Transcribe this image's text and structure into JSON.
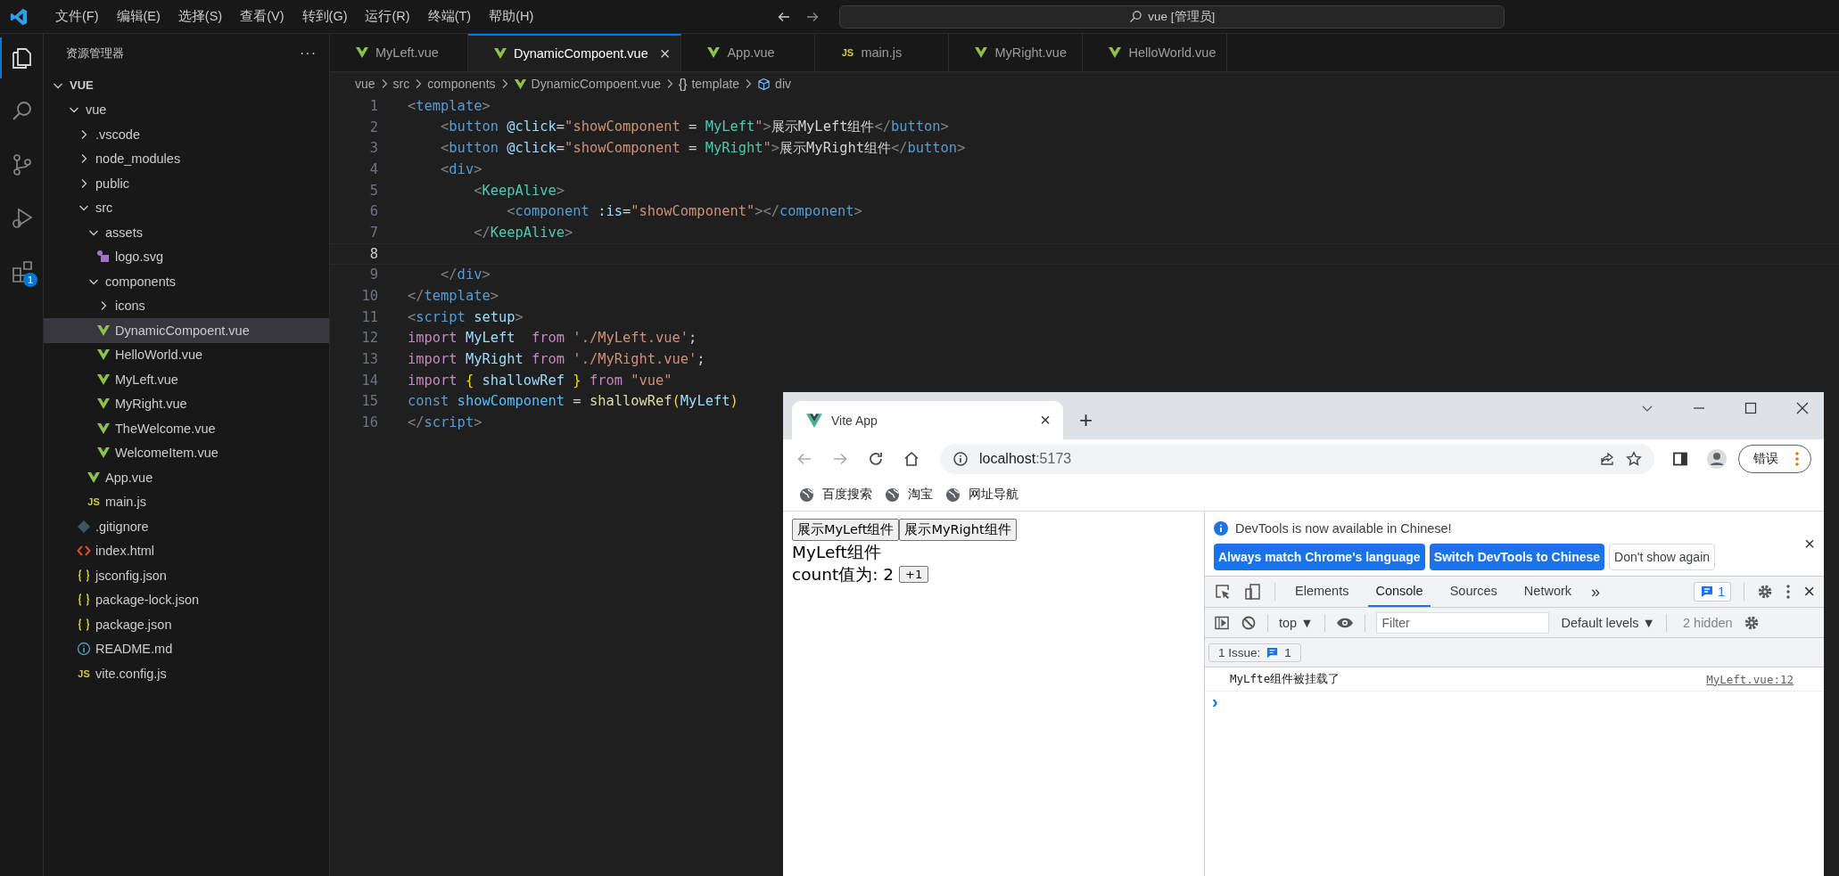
{
  "menu": [
    "文件(F)",
    "编辑(E)",
    "选择(S)",
    "查看(V)",
    "转到(G)",
    "运行(R)",
    "终端(T)",
    "帮助(H)"
  ],
  "command_center": {
    "text": "vue [管理员]"
  },
  "activity_bar": [
    {
      "kind": "files",
      "selected": true
    },
    {
      "kind": "search",
      "selected": false
    },
    {
      "kind": "source-control",
      "selected": false
    },
    {
      "kind": "run-debug",
      "selected": false
    },
    {
      "kind": "extensions",
      "selected": false,
      "badge": "1"
    }
  ],
  "explorer": {
    "title": "资源管理器",
    "more": "···",
    "root": {
      "label": "VUE",
      "expanded": true
    },
    "items": [
      {
        "label": "vue",
        "kind": "folder",
        "expanded": true,
        "selected": false,
        "children": [
          {
            "label": ".vscode",
            "kind": "folder",
            "expanded": false,
            "selected": false
          },
          {
            "label": "node_modules",
            "kind": "folder",
            "expanded": false,
            "selected": false
          },
          {
            "label": "public",
            "kind": "folder",
            "expanded": false,
            "selected": false
          },
          {
            "label": "src",
            "kind": "folder",
            "expanded": true,
            "selected": false,
            "children": [
              {
                "label": "assets",
                "kind": "folder",
                "expanded": true,
                "selected": false,
                "children": [
                  {
                    "label": "logo.svg",
                    "kind": "svg",
                    "selected": false
                  }
                ]
              },
              {
                "label": "components",
                "kind": "folder",
                "expanded": true,
                "selected": false,
                "children": [
                  {
                    "label": "icons",
                    "kind": "folder",
                    "expanded": false,
                    "selected": false
                  },
                  {
                    "label": "DynamicCompoent.vue",
                    "kind": "vue",
                    "selected": true
                  },
                  {
                    "label": "HelloWorld.vue",
                    "kind": "vue",
                    "selected": false
                  },
                  {
                    "label": "MyLeft.vue",
                    "kind": "vue",
                    "selected": false
                  },
                  {
                    "label": "MyRight.vue",
                    "kind": "vue",
                    "selected": false
                  },
                  {
                    "label": "TheWelcome.vue",
                    "kind": "vue",
                    "selected": false
                  },
                  {
                    "label": "WelcomeItem.vue",
                    "kind": "vue",
                    "selected": false
                  }
                ]
              },
              {
                "label": "App.vue",
                "kind": "vue",
                "selected": false
              },
              {
                "label": "main.js",
                "kind": "js",
                "icon_text": "JS",
                "selected": false
              }
            ]
          },
          {
            "label": ".gitignore",
            "kind": "git",
            "selected": false
          },
          {
            "label": "index.html",
            "kind": "html",
            "selected": false
          },
          {
            "label": "jsconfig.json",
            "kind": "json",
            "selected": false
          },
          {
            "label": "package-lock.json",
            "kind": "json",
            "selected": false
          },
          {
            "label": "package.json",
            "kind": "json",
            "selected": false
          },
          {
            "label": "README.md",
            "kind": "info",
            "selected": false
          },
          {
            "label": "vite.config.js",
            "kind": "js",
            "icon_text": "JS",
            "selected": false
          }
        ]
      }
    ]
  },
  "tabs": [
    {
      "label": "MyLeft.vue",
      "kind": "vue",
      "selected": false
    },
    {
      "label": "DynamicCompoent.vue",
      "kind": "vue",
      "selected": true,
      "close": "×"
    },
    {
      "label": "App.vue",
      "kind": "vue",
      "selected": false
    },
    {
      "label": "main.js",
      "kind": "js",
      "icon_text": "JS",
      "selected": false
    },
    {
      "label": "MyRight.vue",
      "kind": "vue",
      "selected": false
    },
    {
      "label": "HelloWorld.vue",
      "kind": "vue",
      "selected": false
    }
  ],
  "breadcrumb": [
    {
      "label": "vue",
      "kind": "plain"
    },
    {
      "label": "src",
      "kind": "plain"
    },
    {
      "label": "components",
      "kind": "plain"
    },
    {
      "label": "DynamicCompoent.vue",
      "kind": "vue"
    },
    {
      "label": "template",
      "kind": "braces",
      "icon_text": "{}"
    },
    {
      "label": "div",
      "kind": "cube"
    }
  ],
  "code": [
    {
      "number": "1",
      "current": false,
      "tokens": [
        {
          "text": "<",
          "kind": "punct"
        },
        {
          "text": "template",
          "kind": "tag"
        },
        {
          "text": ">",
          "kind": "punct"
        }
      ]
    },
    {
      "number": "2",
      "current": false,
      "tokens": [
        {
          "text": "    <",
          "kind": "punct"
        },
        {
          "text": "button",
          "kind": "tag"
        },
        {
          "text": " @click",
          "kind": "attr"
        },
        {
          "text": "=",
          "kind": "plain"
        },
        {
          "text": "\"showComponent",
          "kind": "string"
        },
        {
          "text": " = ",
          "kind": "plain"
        },
        {
          "text": "MyLeft",
          "kind": "component"
        },
        {
          "text": "\"",
          "kind": "string"
        },
        {
          "text": ">",
          "kind": "punct"
        },
        {
          "text": "展示MyLeft组件",
          "kind": "plain"
        },
        {
          "text": "</",
          "kind": "punct"
        },
        {
          "text": "button",
          "kind": "tag"
        },
        {
          "text": ">",
          "kind": "punct"
        }
      ]
    },
    {
      "number": "3",
      "current": false,
      "tokens": [
        {
          "text": "    <",
          "kind": "punct"
        },
        {
          "text": "button",
          "kind": "tag"
        },
        {
          "text": " @click",
          "kind": "attr"
        },
        {
          "text": "=",
          "kind": "plain"
        },
        {
          "text": "\"showComponent",
          "kind": "string"
        },
        {
          "text": " = ",
          "kind": "plain"
        },
        {
          "text": "MyRight",
          "kind": "component"
        },
        {
          "text": "\"",
          "kind": "string"
        },
        {
          "text": ">",
          "kind": "punct"
        },
        {
          "text": "展示MyRight组件",
          "kind": "plain"
        },
        {
          "text": "</",
          "kind": "punct"
        },
        {
          "text": "button",
          "kind": "tag"
        },
        {
          "text": ">",
          "kind": "punct"
        }
      ]
    },
    {
      "number": "4",
      "current": false,
      "tokens": [
        {
          "text": "    <",
          "kind": "punct"
        },
        {
          "text": "div",
          "kind": "tag"
        },
        {
          "text": ">",
          "kind": "punct"
        }
      ]
    },
    {
      "number": "5",
      "current": false,
      "tokens": [
        {
          "text": "        <",
          "kind": "punct"
        },
        {
          "text": "KeepAlive",
          "kind": "component"
        },
        {
          "text": ">",
          "kind": "punct"
        }
      ]
    },
    {
      "number": "6",
      "current": false,
      "tokens": [
        {
          "text": "            <",
          "kind": "punct"
        },
        {
          "text": "component",
          "kind": "tag"
        },
        {
          "text": " :is",
          "kind": "attr"
        },
        {
          "text": "=",
          "kind": "plain"
        },
        {
          "text": "\"showComponent\"",
          "kind": "string"
        },
        {
          "text": "></",
          "kind": "punct"
        },
        {
          "text": "component",
          "kind": "tag"
        },
        {
          "text": ">",
          "kind": "punct"
        }
      ]
    },
    {
      "number": "7",
      "current": false,
      "tokens": [
        {
          "text": "        </",
          "kind": "punct"
        },
        {
          "text": "KeepAlive",
          "kind": "component"
        },
        {
          "text": ">",
          "kind": "punct"
        }
      ]
    },
    {
      "number": "8",
      "current": true
    },
    {
      "number": "9",
      "current": false,
      "tokens": [
        {
          "text": "    </",
          "kind": "punct"
        },
        {
          "text": "div",
          "kind": "tag"
        },
        {
          "text": ">",
          "kind": "punct"
        }
      ]
    },
    {
      "number": "10",
      "current": false,
      "tokens": [
        {
          "text": "</",
          "kind": "punct"
        },
        {
          "text": "template",
          "kind": "tag"
        },
        {
          "text": ">",
          "kind": "punct"
        }
      ]
    },
    {
      "number": "11",
      "current": false,
      "tokens": [
        {
          "text": "<",
          "kind": "punct"
        },
        {
          "text": "script",
          "kind": "tag"
        },
        {
          "text": " setup",
          "kind": "attr"
        },
        {
          "text": ">",
          "kind": "punct"
        }
      ]
    },
    {
      "number": "12",
      "current": false,
      "tokens": [
        {
          "text": "import",
          "kind": "keyword"
        },
        {
          "text": " MyLeft",
          "kind": "variable"
        },
        {
          "text": "  from",
          "kind": "keyword"
        },
        {
          "text": " './MyLeft.vue'",
          "kind": "string"
        },
        {
          "text": ";",
          "kind": "plain"
        }
      ]
    },
    {
      "number": "13",
      "current": false,
      "tokens": [
        {
          "text": "import",
          "kind": "keyword"
        },
        {
          "text": " MyRight",
          "kind": "variable"
        },
        {
          "text": " from",
          "kind": "keyword"
        },
        {
          "text": " './MyRight.vue'",
          "kind": "string"
        },
        {
          "text": ";",
          "kind": "plain"
        }
      ]
    },
    {
      "number": "14",
      "current": false,
      "tokens": [
        {
          "text": "import",
          "kind": "keyword"
        },
        {
          "text": " {",
          "kind": "brace"
        },
        {
          "text": " shallowRef",
          "kind": "variable"
        },
        {
          "text": " }",
          "kind": "brace"
        },
        {
          "text": " from",
          "kind": "keyword"
        },
        {
          "text": " \"vue\"",
          "kind": "string"
        }
      ]
    },
    {
      "number": "15",
      "current": false,
      "tokens": [
        {
          "text": "const",
          "kind": "declaration"
        },
        {
          "text": " showComponent",
          "kind": "constant"
        },
        {
          "text": " = ",
          "kind": "plain"
        },
        {
          "text": "shallowRef",
          "kind": "function"
        },
        {
          "text": "(",
          "kind": "brace"
        },
        {
          "text": "MyLeft",
          "kind": "variable"
        },
        {
          "text": ")",
          "kind": "brace"
        }
      ]
    },
    {
      "number": "16",
      "current": false,
      "tokens": [
        {
          "text": "</",
          "kind": "punct"
        },
        {
          "text": "script",
          "kind": "tag"
        },
        {
          "text": ">",
          "kind": "punct"
        }
      ]
    }
  ],
  "browser": {
    "tab": {
      "title": "Vite App",
      "close": "×"
    },
    "new_tab": "+",
    "address": {
      "host": "localhost",
      "port": ":5173"
    },
    "profile_button": "错误",
    "bookmarks": [
      "百度搜索",
      "淘宝",
      "网址导航"
    ],
    "page": {
      "buttons": [
        "展示MyLeft组件",
        "展示MyRight组件"
      ],
      "heading": "MyLeft组件",
      "count_text": "count值为: 2",
      "increment_button": "+1"
    },
    "devtools": {
      "notice": "DevTools is now available in Chinese!",
      "notice_buttons": [
        {
          "label": "Always match Chrome's language",
          "kind": "primary"
        },
        {
          "label": "Switch DevTools to Chinese",
          "kind": "primary"
        },
        {
          "label": "Don't show again",
          "kind": "secondary"
        }
      ],
      "notice_close": "×",
      "tabs": [
        {
          "label": "Elements",
          "selected": false
        },
        {
          "label": "Console",
          "selected": true
        },
        {
          "label": "Sources",
          "selected": false
        },
        {
          "label": "Network",
          "selected": false
        }
      ],
      "more_tabs": "»",
      "issues_badge": "1",
      "close": "×",
      "context": "top ▼",
      "filter_placeholder": "Filter",
      "levels": "Default levels ▼",
      "hidden": "2 hidden",
      "issues": {
        "label": "1 Issue:",
        "count": "1"
      },
      "messages": [
        {
          "text": "MyLfte组件被挂载了",
          "source": "MyLeft.vue:12"
        }
      ],
      "prompt": "›"
    }
  }
}
